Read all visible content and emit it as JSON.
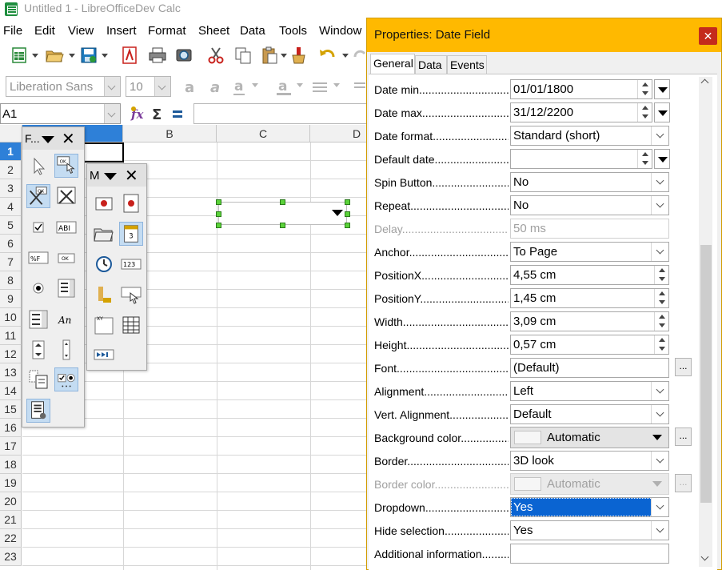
{
  "window": {
    "title": "Untitled 1 - LibreOfficeDev Calc"
  },
  "menu": [
    "File",
    "Edit",
    "View",
    "Insert",
    "Format",
    "Sheet",
    "Data",
    "Tools",
    "Window"
  ],
  "format_toolbar": {
    "font_name": "Liberation Sans",
    "font_size": "10"
  },
  "formula_bar": {
    "name_box": "A1",
    "function_icon": "fx-icon",
    "sum_icon": "sigma-icon",
    "equals_icon": "equals-icon"
  },
  "grid": {
    "columns": [
      "",
      "B",
      "C",
      "D"
    ],
    "rows": [
      "1",
      "2",
      "3",
      "4",
      "5",
      "6",
      "7",
      "8",
      "9",
      "10",
      "11",
      "12",
      "13",
      "14",
      "15",
      "16",
      "17",
      "18",
      "19",
      "20",
      "21",
      "22",
      "23"
    ],
    "selected_row": "1"
  },
  "form_controls_toolbar": {
    "title": "F...",
    "close": "✕"
  },
  "more_controls_toolbar": {
    "title": "M",
    "close": "✕"
  },
  "dialog": {
    "title": "Properties: Date Field",
    "close": "✕",
    "tabs": [
      "General",
      "Data",
      "Events"
    ],
    "selected_tab": "General",
    "properties": [
      {
        "label": "Date min",
        "value": "01/01/1800",
        "control": "spin-dropdown"
      },
      {
        "label": "Date max",
        "value": "31/12/2200",
        "control": "spin-dropdown"
      },
      {
        "label": "Date format",
        "value": "Standard (short)",
        "control": "list"
      },
      {
        "label": "Default date",
        "value": "",
        "control": "spin-dropdown"
      },
      {
        "label": "Spin Button",
        "value": "No",
        "control": "list"
      },
      {
        "label": "Repeat",
        "value": "No",
        "control": "list"
      },
      {
        "label": "Delay",
        "value": "50 ms",
        "control": "text",
        "disabled": true
      },
      {
        "label": "Anchor",
        "value": "To Page",
        "control": "list"
      },
      {
        "label": "PositionX",
        "value": "4,55 cm",
        "control": "spin"
      },
      {
        "label": "PositionY",
        "value": "1,45 cm",
        "control": "spin"
      },
      {
        "label": "Width",
        "value": "3,09 cm",
        "control": "spin"
      },
      {
        "label": "Height",
        "value": "0,57 cm",
        "control": "spin"
      },
      {
        "label": "Font",
        "value": "(Default)",
        "control": "text-button",
        "button": "..."
      },
      {
        "label": "Alignment",
        "value": "Left",
        "control": "list"
      },
      {
        "label": "Vert. Alignment",
        "value": "Default",
        "control": "list"
      },
      {
        "label": "Background color",
        "value": "Automatic",
        "control": "color",
        "button": "..."
      },
      {
        "label": "Border",
        "value": "3D look",
        "control": "list"
      },
      {
        "label": "Border color",
        "value": "Automatic",
        "control": "color",
        "button": "...",
        "disabled": true
      },
      {
        "label": "Dropdown",
        "value": "Yes",
        "control": "list",
        "highlighted": true
      },
      {
        "label": "Hide selection",
        "value": "Yes",
        "control": "list"
      },
      {
        "label": "Additional information",
        "value": "",
        "control": "text"
      }
    ]
  },
  "colors": {
    "dialog_title_bg": "#ffb900",
    "selection_blue": "#0a64d2",
    "row_header_selected": "#2e80d8",
    "close_red": "#c42b1c"
  }
}
